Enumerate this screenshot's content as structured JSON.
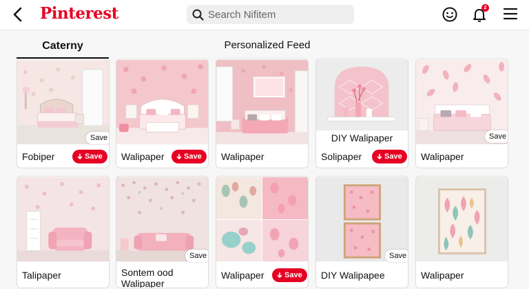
{
  "header": {
    "logo": "Pinterest",
    "search_placeholder": "Search Nifitem",
    "notification_count": "2"
  },
  "tabs": {
    "category": "Caterny",
    "feed": "Personalized Feed"
  },
  "pins": [
    {
      "label": "Fobiper",
      "save_red": "Save",
      "save_chip": "Save"
    },
    {
      "label": "Walipaper",
      "save_red": "Save"
    },
    {
      "label": "Walipaper"
    },
    {
      "label": "Solipaper",
      "save_red": "Save",
      "overlay_title": "DIY Walipaper"
    },
    {
      "label": "Walipaper",
      "save_chip": "Save"
    },
    {
      "label": "Talipaper"
    },
    {
      "label": "Sontem ood Walipaper",
      "save_chip": "Save"
    },
    {
      "label": "Walipaper",
      "save_red": "Save"
    },
    {
      "label": "DIY Walipapee",
      "save_chip": "Save"
    },
    {
      "label": "Walipaper"
    }
  ],
  "colors": {
    "brand": "#e60023"
  }
}
